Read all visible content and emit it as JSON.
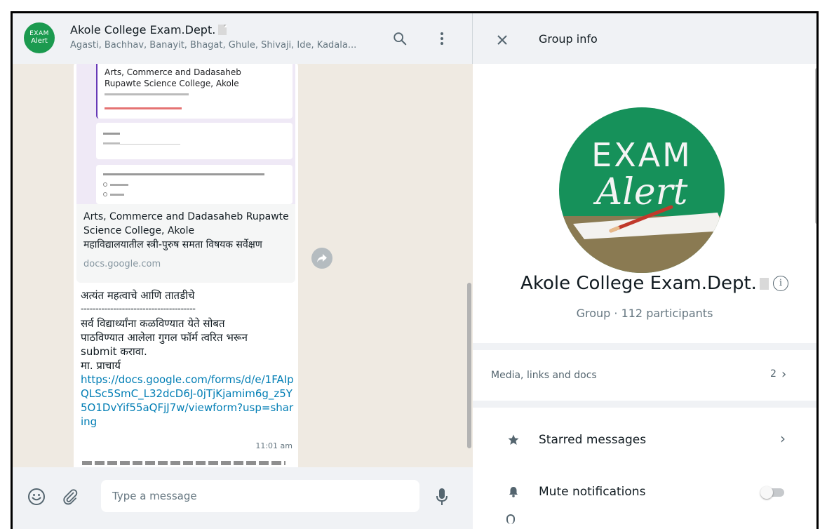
{
  "chat": {
    "title": "Akole College Exam.Dept.",
    "subtitle": "Agasti, Bachhav, Banayit, Bhagat, Ghule, Shivaji, Ide, Kadala...",
    "avatar_text_1": "EXAM",
    "avatar_text_2": "Alert"
  },
  "preview": {
    "form_title": "Arts, Commerce and Dadasaheb Rupawte Science College, Akole",
    "title": "Arts, Commerce and Dadasaheb Rupawte Science College, Akole",
    "description": "महाविद्यालयातील स्त्री-पुरुष समता विषयक सर्वेक्षण",
    "domain": "docs.google.com"
  },
  "message": {
    "line1": "अत्यंत महत्वाचे आणि तातडीचे",
    "separator": "---------------------------------------",
    "line2": "सर्व विद्यार्थ्यांना कळविण्यात येते सोबत",
    "line3": "पाठविण्यात आलेला गुगल फॉर्म त्वरित भरून",
    "line4": "submit करावा.",
    "line5": "मा. प्राचार्य",
    "link": "https://docs.google.com/forms/d/e/1FAIpQLSc5SmC_L32dcD6J-0jTjKjamim6g_z5Y5O1DvYif55aQFjJ7w/viewform?usp=sharing",
    "time": "11:01 am"
  },
  "composer": {
    "placeholder": "Type a message"
  },
  "info": {
    "header_title": "Group info",
    "group_name": "Akole College Exam.Dept.",
    "group_meta": "Group · 112 participants",
    "avatar_text_1": "EXAM",
    "avatar_text_2": "Alert",
    "media_label": "Media, links and docs",
    "media_count": "2",
    "starred_label": "Starred messages",
    "mute_label": "Mute notifications",
    "mute_enabled": false
  },
  "icons": {
    "search": "search-icon",
    "menu": "menu-icon",
    "emoji": "emoji-icon",
    "attach": "paperclip-icon",
    "mic": "mic-icon",
    "close": "close-icon",
    "forward": "forward-icon",
    "star": "star-icon",
    "bell": "bell-icon",
    "info": "info-icon"
  },
  "colors": {
    "link": "#027eb5",
    "avatar_green": "#1b9a4f",
    "panel_bg": "#f0f2f5",
    "chat_bg": "#efeae2"
  }
}
